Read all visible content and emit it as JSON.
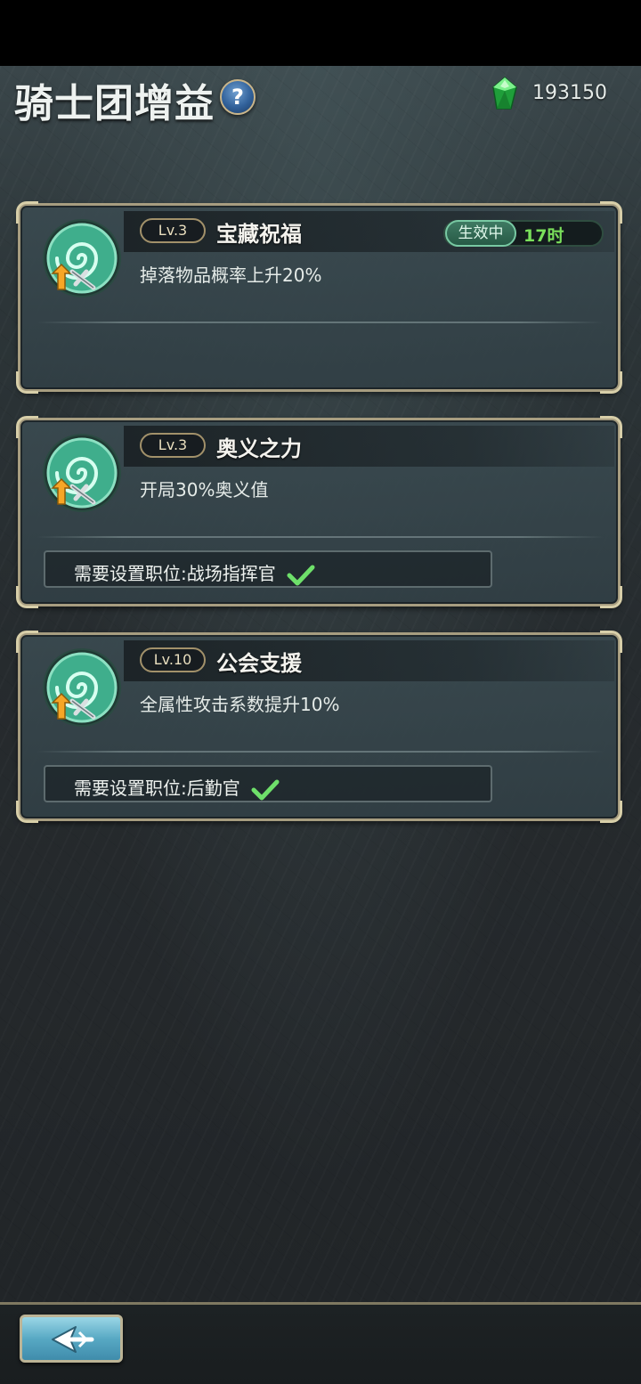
{
  "header": {
    "title": "骑士团增益",
    "help_icon": "question-mark-icon",
    "help_label": "?",
    "currency_icon": "green-gem-icon",
    "currency_amount": "193150"
  },
  "buffs": [
    {
      "level": "Lv.3",
      "name": "宝藏祝福",
      "description": "掉落物品概率上升20%",
      "icon": "green-swirl-buff-icon",
      "status_label": "生效中",
      "time_left": "17时",
      "requirement": ""
    },
    {
      "level": "Lv.3",
      "name": "奥义之力",
      "description": "开局30%奥义值",
      "icon": "green-swirl-buff-icon",
      "requirement": "需要设置职位:战场指挥官",
      "requirement_met": true
    },
    {
      "level": "Lv.10",
      "name": "公会支援",
      "description": "全属性攻击系数提升10%",
      "icon": "green-swirl-buff-icon",
      "requirement": "需要设置职位:后勤官",
      "requirement_met": true
    }
  ],
  "footer": {
    "back_icon": "back-arrow-icon"
  },
  "colors": {
    "accent_green": "#7ae05b",
    "check_green": "#6ee06a",
    "frame_gold": "#a79d80",
    "active_pill": "#3f7a63"
  }
}
